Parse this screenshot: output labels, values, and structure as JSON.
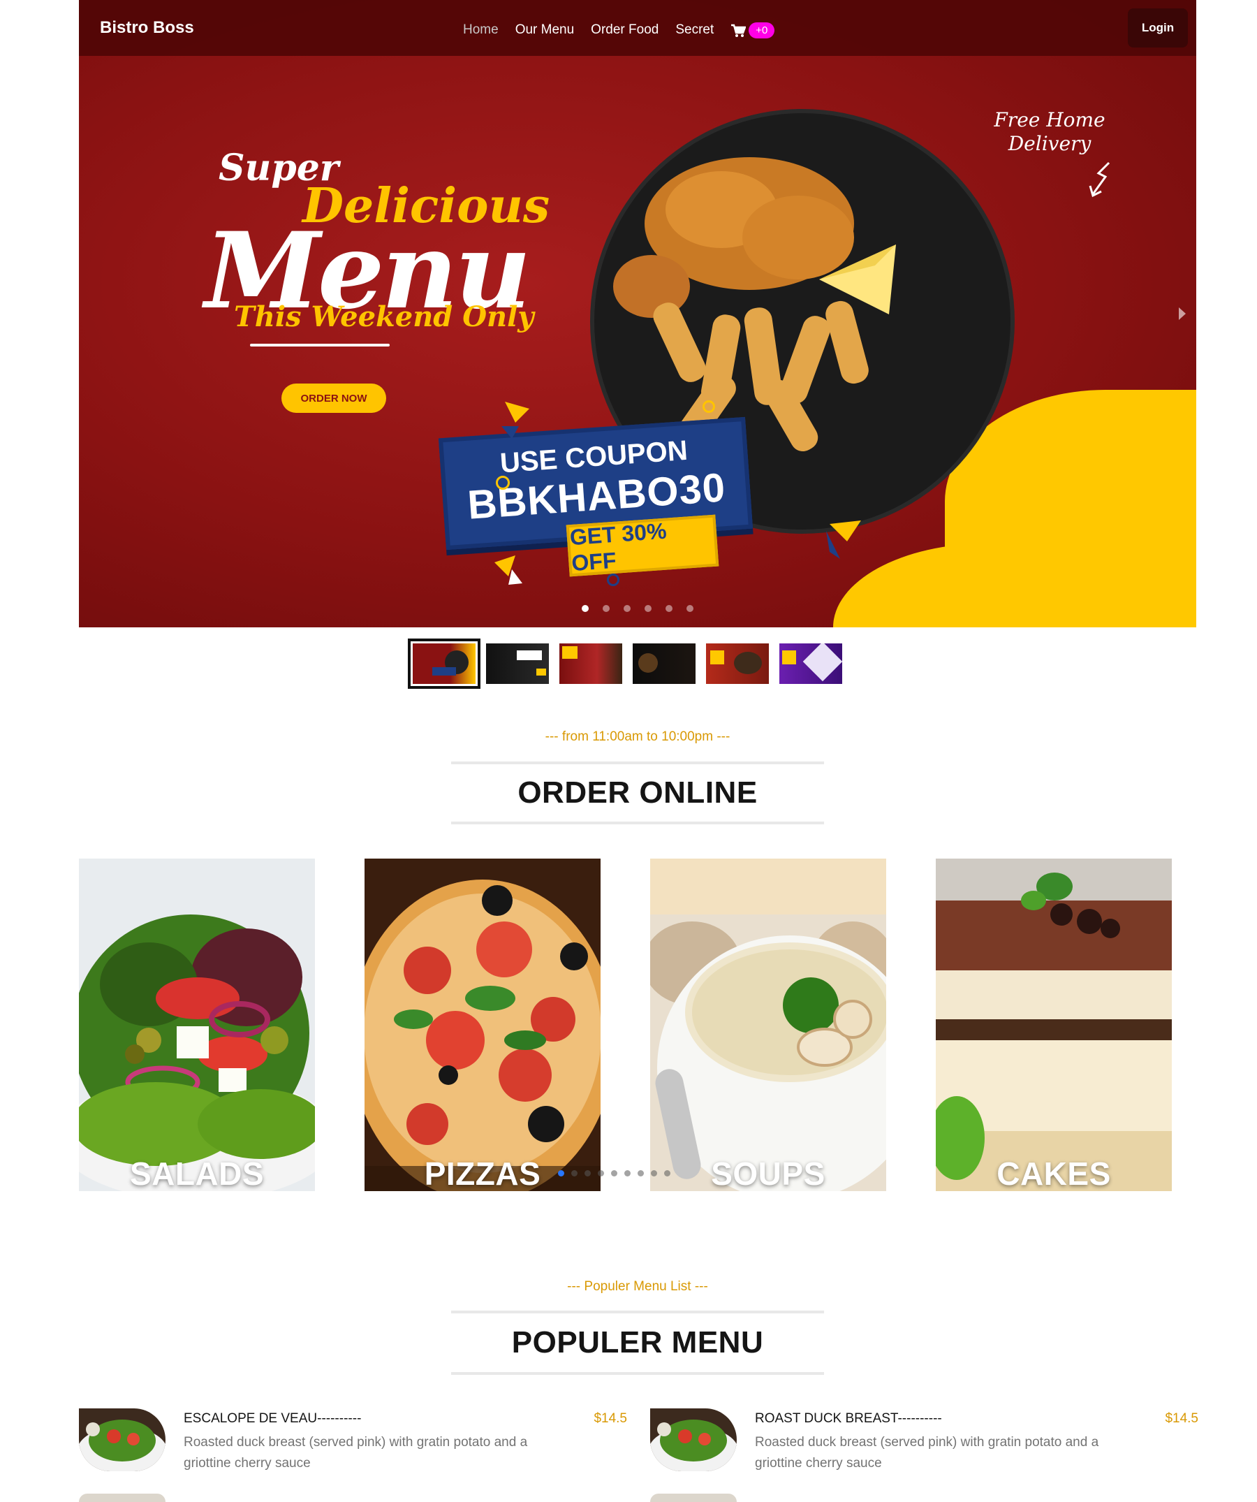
{
  "navbar": {
    "brand": "Bistro Boss",
    "links": [
      "Home",
      "Our Menu",
      "Order Food",
      "Secret"
    ],
    "cart_count": "+0",
    "login_label": "Login"
  },
  "hero": {
    "super": "Super",
    "delicious": "Delicious",
    "menu": "Menu",
    "weekend": "This Weekend Only",
    "order_now": "ORDER NOW",
    "coupon_line1": "USE COUPON",
    "coupon_code": "BBKHABO30",
    "coupon_off": "GET 30% OFF",
    "free_delivery": "Free Home Delivery",
    "slide_count": 6,
    "active_slide": 1
  },
  "order_online": {
    "subtitle": "--- from 11:00am to 10:00pm ---",
    "title": "ORDER ONLINE",
    "categories": [
      "SALADS",
      "PIZZAS",
      "SOUPS",
      "CAKES"
    ]
  },
  "popular": {
    "subtitle": "--- Populer Menu List ---",
    "title": "POPULER MENU",
    "items": [
      {
        "name": "ESCALOPE DE VEAU----------",
        "desc": "Roasted duck breast (served pink) with gratin potato and a griottine cherry sauce",
        "price": "$14.5"
      },
      {
        "name": "ROAST DUCK BREAST----------",
        "desc": "Roasted duck breast (served pink) with gratin potato and a griottine cherry sauce",
        "price": "$14.5"
      }
    ]
  },
  "colors": {
    "accent": "#d99904",
    "nav_bg": "#500505",
    "cart_badge": "#ff00e6",
    "hero_red": "#8a1212",
    "hero_yellow": "#ffc800"
  }
}
